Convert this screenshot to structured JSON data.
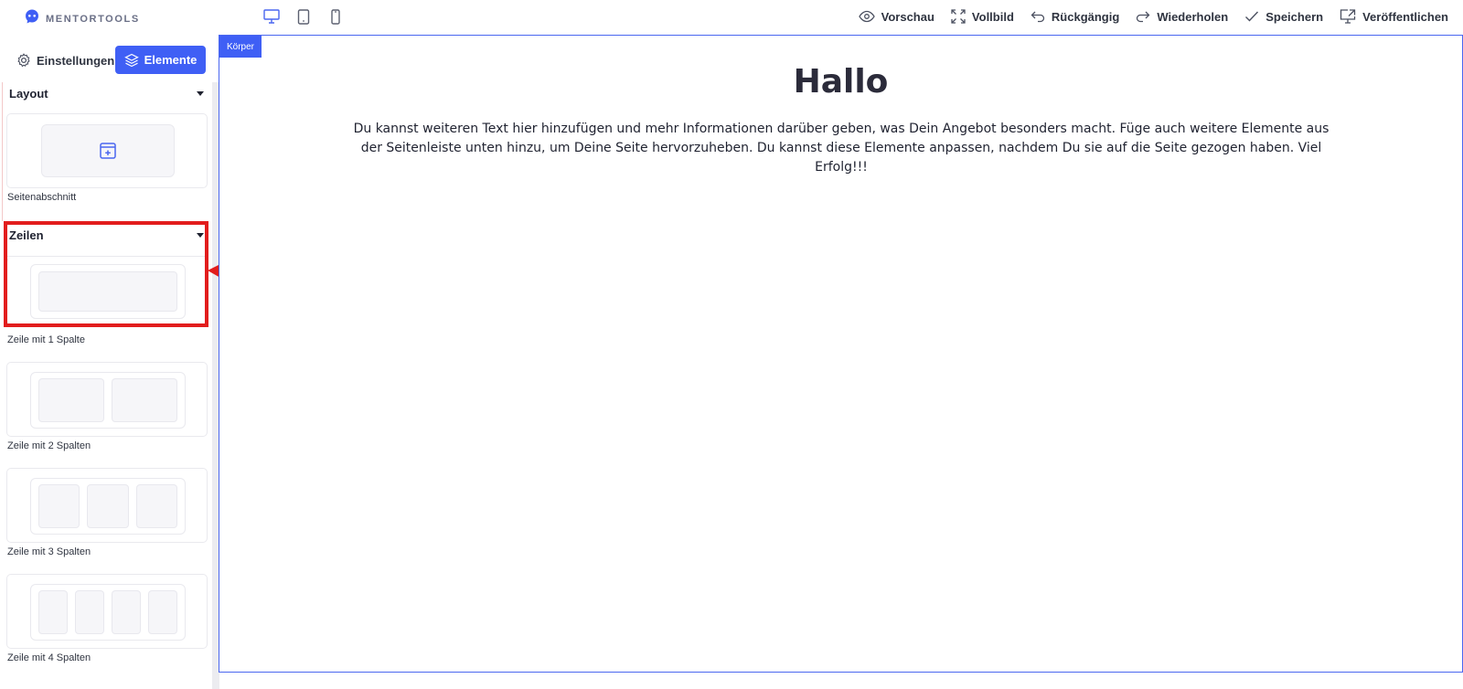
{
  "app": {
    "logo_text": "MENTORTOOLS"
  },
  "devices": [
    {
      "name": "desktop",
      "active": true
    },
    {
      "name": "tablet",
      "active": false
    },
    {
      "name": "mobile",
      "active": false
    }
  ],
  "actions": {
    "preview": "Vorschau",
    "fullscreen": "Vollbild",
    "undo": "Rückgängig",
    "redo": "Wiederholen",
    "save": "Speichern",
    "publish": "Veröffentlichen"
  },
  "sidebar": {
    "tab_settings": "Einstellungen",
    "tab_elements": "Elemente",
    "layout_section": {
      "title": "Layout",
      "items": [
        {
          "label": "Seitenabschnitt"
        }
      ]
    },
    "rows_section": {
      "title": "Zeilen",
      "items": [
        {
          "label": "Zeile mit 1 Spalte",
          "columns": 1
        },
        {
          "label": "Zeile mit 2 Spalten",
          "columns": 2
        },
        {
          "label": "Zeile mit 3 Spalten",
          "columns": 3
        },
        {
          "label": "Zeile mit 4 Spalten",
          "columns": 4
        }
      ]
    }
  },
  "canvas": {
    "body_tag": "Körper",
    "title": "Hallo",
    "text": "Du kannst weiteren Text hier hinzufügen und mehr Informationen darüber geben, was Dein Angebot besonders macht. Füge auch weitere Elemente aus der Seitenleiste unten hinzu, um Deine Seite hervorzuheben. Du kannst diese Elemente anpassen, nachdem Du sie auf die Seite gezogen haben. Viel Erfolg!!!"
  },
  "colors": {
    "accent": "#3f5ff5",
    "highlight": "#e21d1d",
    "text": "#2b2b3a"
  }
}
